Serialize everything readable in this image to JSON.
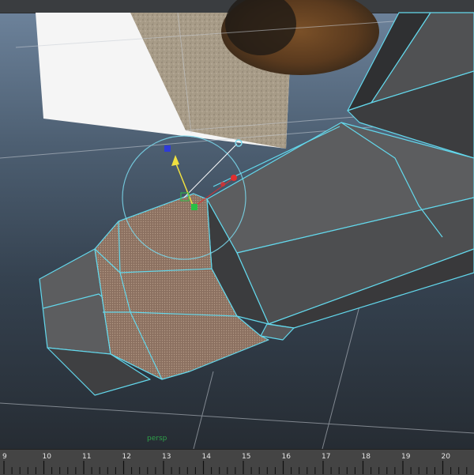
{
  "viewport": {
    "camera_label": "persp",
    "colors": {
      "wire": "#63d8ec",
      "face_dark": "#4b4c4e",
      "face_mid": "#5a5b5d",
      "face_light": "#626365",
      "selected": "#8a7262",
      "bg_top": "#6f859e",
      "bg_bottom": "#262c33",
      "ref_white": "#f4f4f4"
    },
    "icons": [
      "move-manipulator-icon",
      "rotate-manipulator-icon",
      "image-plane-icon"
    ]
  },
  "timeline": {
    "frames": [
      "9",
      "10",
      "11",
      "12",
      "13",
      "14",
      "15",
      "16",
      "17",
      "18",
      "19",
      "20"
    ]
  }
}
